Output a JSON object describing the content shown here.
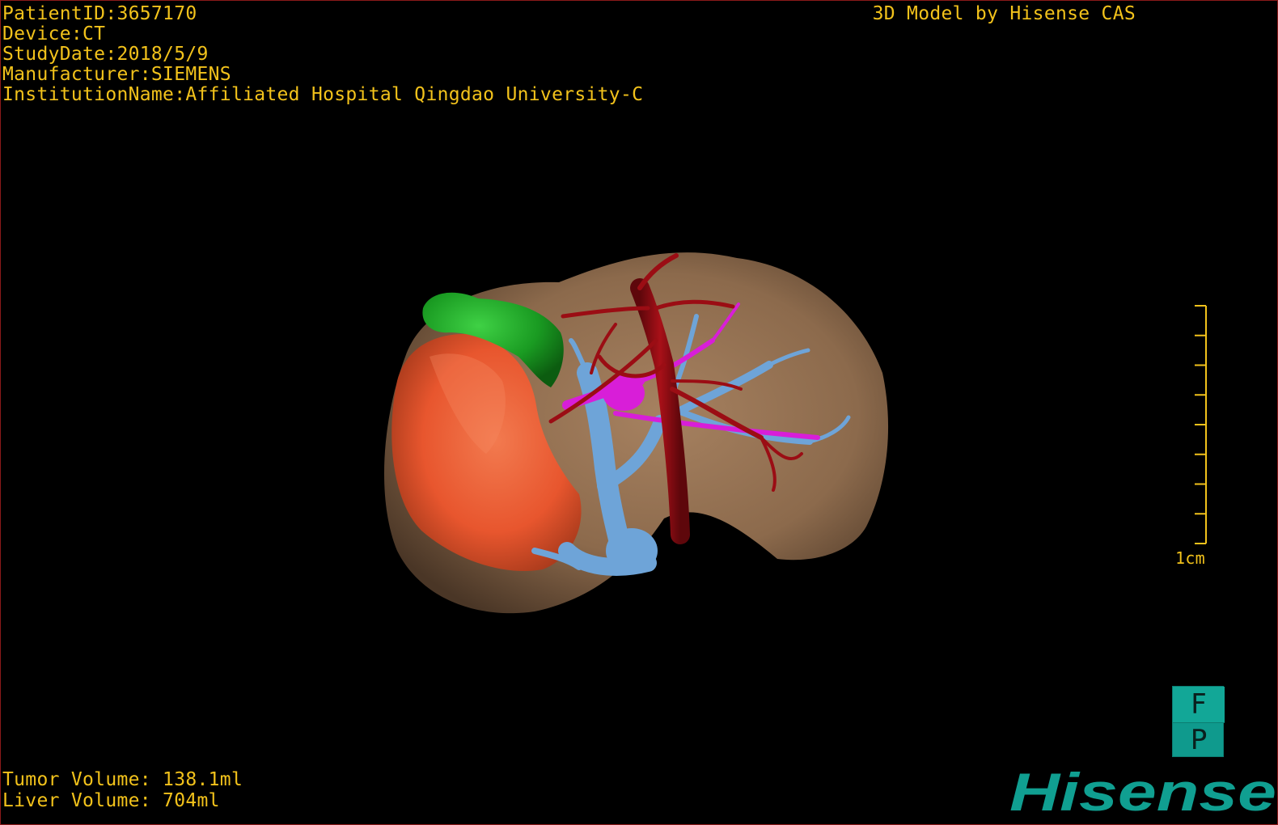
{
  "study_info": {
    "patient_id": "PatientID:3657170",
    "device": "Device:CT",
    "study_date": "StudyDate:2018/5/9",
    "manufacturer": "Manufacturer:SIEMENS",
    "institution": "InstitutionName:Affiliated Hospital Qingdao University-C"
  },
  "watermark": "3D Model by Hisense CAS",
  "volumes": {
    "tumor": "Tumor Volume: 138.1ml",
    "liver": "Liver Volume: 704ml"
  },
  "scale_bar": {
    "label": "1cm",
    "ticks": 9
  },
  "orientation_cube": {
    "top_letter": "F",
    "bottom_letter": "P"
  },
  "brand": {
    "name": "Hisense",
    "color": "#109f91"
  },
  "colors": {
    "overlay_text": "#f2c21b",
    "liver": "#8c6a4c",
    "tumor": "#e8562e",
    "gallbladder": "#1a9b22",
    "hepatic_artery": "#9b0d14",
    "portal_vein": "#6ea4d8",
    "bile_duct": "#d81ed8"
  }
}
